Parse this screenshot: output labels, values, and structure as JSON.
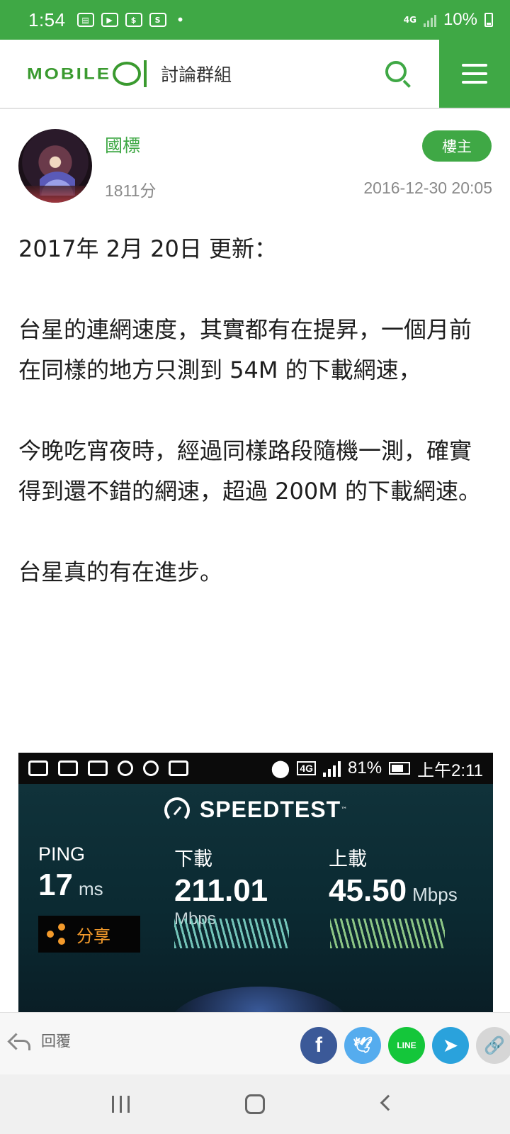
{
  "status_bar": {
    "time": "1:54",
    "network": "4G",
    "battery": "10%"
  },
  "header": {
    "logo": "MOBILE01",
    "title": "討論群組"
  },
  "post": {
    "username": "國標",
    "points": "1811分",
    "badge": "樓主",
    "date": "2016-12-30 20:05",
    "paragraphs": [
      "2017年 2月 20日 更新：",
      "台星的連網速度，其實都有在提昇，一個月前在同樣的地方只測到 54M 的下載網速，",
      "今晚吃宵夜時，經過同樣路段隨機一測，確實得到還不錯的網速，超過 200M 的下載網速。",
      "台星真的有在進步。"
    ]
  },
  "speedtest": {
    "status_battery": "81%",
    "status_time": "上午2:11",
    "status_network": "4G",
    "brand": "SPEEDTEST",
    "ping_label": "PING",
    "ping_value": "17",
    "ping_unit": "ms",
    "share_label": "分享",
    "download_label": "下載",
    "download_value": "211.01",
    "download_unit": "Mbps",
    "upload_label": "上載",
    "upload_value": "45.50",
    "upload_unit": "Mbps"
  },
  "actions": {
    "reply_label": "回覆",
    "share_buttons": [
      "f",
      "t",
      "LINE",
      "telegram",
      "link"
    ]
  },
  "colors": {
    "brand_green": "#3fa845",
    "facebook": "#3b5998",
    "twitter": "#55acee",
    "line": "#14c63a",
    "telegram": "#2aa2dc"
  }
}
